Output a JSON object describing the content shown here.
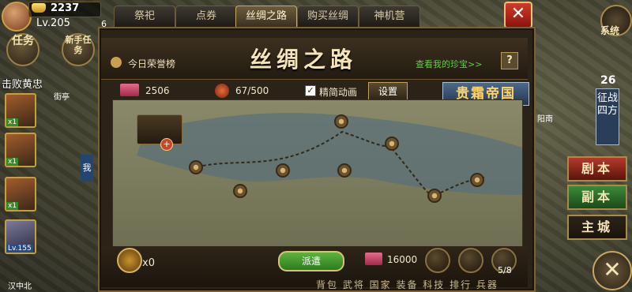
{
  "hud": {
    "gold": "2237",
    "level": "Lv.205",
    "vip": "6",
    "task_label": "任务",
    "new_label": "新手任务",
    "defeat_text": "击败黄忠",
    "place_jieting": "街亭",
    "place_hanzhongbei": "汉中北",
    "me_label": "我",
    "heroes": [
      {
        "badge": "x1"
      },
      {
        "badge": "x1"
      },
      {
        "badge": "x1"
      },
      {
        "badge": "Lv.155"
      }
    ]
  },
  "tabs": [
    {
      "label": "祭祀"
    },
    {
      "label": "点券"
    },
    {
      "label": "丝绸之路"
    },
    {
      "label": "购买丝绸"
    },
    {
      "label": "神机营"
    }
  ],
  "close_glyph": "✕",
  "panel": {
    "title": "丝绸之路",
    "honor_label": "今日荣誉榜",
    "treasure_link": "查看我的珍宝>>",
    "help_label": "?",
    "silk_count": "2506",
    "progress": "67/500",
    "simple_anim_label": "精简动画",
    "simple_anim_checked": true,
    "check_glyph": "✓",
    "settings_label": "设置",
    "empire_label": "贵霜帝国",
    "bottom": {
      "x_count": "x0",
      "dispatch_label": "派遣",
      "silk_cost": "16000",
      "tool_count": "5/8"
    }
  },
  "right": {
    "system_label": "系统",
    "conquest_count": "26",
    "conquest_label": "征战四方",
    "city_label": "阳南",
    "buttons": [
      {
        "label": "剧本"
      },
      {
        "label": "副本"
      },
      {
        "label": "主城"
      }
    ],
    "bottom_nav": "背包 武将 国家 装备 科技 排行 兵器"
  },
  "colors": {
    "treasure_link": "#5ed13d",
    "empire_text": "#ffd36a",
    "dispatch": "#3f9a2c"
  }
}
